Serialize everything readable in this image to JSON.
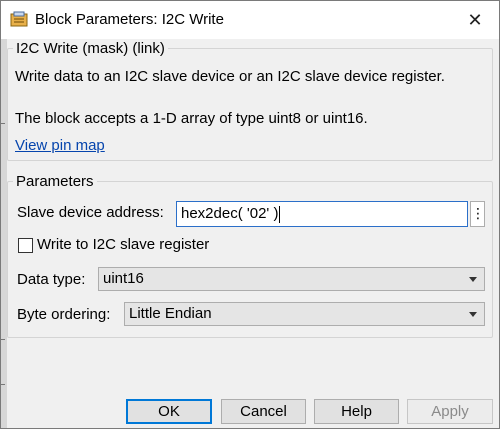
{
  "window": {
    "title": "Block Parameters: I2C Write",
    "close_glyph": "✕",
    "icon": "block-icon"
  },
  "mask": {
    "header": "I2C Write (mask) (link)",
    "description_line1": "Write data to an I2C slave device or an I2C slave device register.",
    "description_line2": "The block accepts a 1-D array of type uint8 or uint16.",
    "link_text": "View pin map"
  },
  "parameters": {
    "header": "Parameters",
    "slave_address_label": "Slave device address:",
    "slave_address_value": "hex2dec( '02' )",
    "kebab_glyph": "⋮",
    "write_register_label": "Write to I2C slave register",
    "write_register_checked": false,
    "data_type_label": "Data type:",
    "data_type_value": "uint16",
    "byte_ordering_label": "Byte ordering:",
    "byte_ordering_value": "Little Endian"
  },
  "buttons": {
    "ok": "OK",
    "cancel": "Cancel",
    "help": "Help",
    "apply": "Apply"
  },
  "colors": {
    "accent": "#0078d7",
    "link": "#0645ad",
    "disabled_text": "#8a8a8a"
  }
}
